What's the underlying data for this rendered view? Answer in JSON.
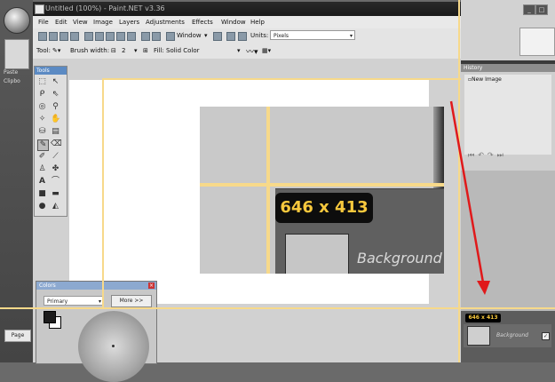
{
  "window": {
    "title": "Untitled (100%) - Paint.NET v3.36",
    "controls": [
      "_",
      "□",
      "×"
    ]
  },
  "left_strip": {
    "paste_label": "Paste",
    "clipboard_label": "Clipbo",
    "pages_label": "Page"
  },
  "menu": [
    "File",
    "Edit",
    "View",
    "Image",
    "Layers",
    "Adjustments",
    "Effects",
    "Window",
    "Help"
  ],
  "toolbar1": {
    "window_label": "Window",
    "units_label": "Units:",
    "units_value": "Pixels"
  },
  "toolbar2": {
    "tool_label": "Tool:",
    "brush_label": "Brush width:",
    "brush_value": "2",
    "fill_label": "Fill:",
    "fill_value": "Solid Color"
  },
  "tools_panel": {
    "title": "Tools"
  },
  "colors_panel": {
    "title": "Colors",
    "mode": "Primary",
    "more_label": "More >>"
  },
  "history_panel": {
    "title": "History",
    "items": [
      "New Image"
    ]
  },
  "canvas": {
    "size_badge": "646 x 413",
    "layer_text": "Background"
  },
  "layers_panel": {
    "size_badge": "646 x 413",
    "layer_name": "Background"
  },
  "colors": {
    "guide": "#f7d98a",
    "arrow": "#e0191b",
    "badge_text": "#f7c83d"
  }
}
